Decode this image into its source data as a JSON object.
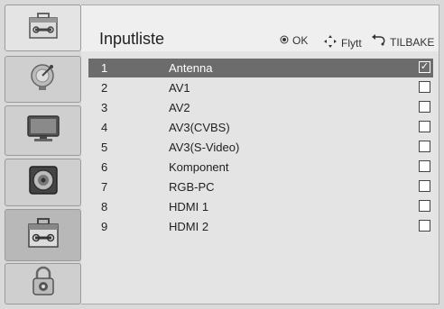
{
  "header": {
    "title": "Inputliste",
    "hints": {
      "ok_label": "OK",
      "move_label": "Flytt",
      "back_label": "TILBAKE"
    }
  },
  "sidebar": {
    "tabs": [
      {
        "icon": "toolbox-icon"
      },
      {
        "icon": "satellite-dish-icon"
      },
      {
        "icon": "tv-monitor-icon"
      },
      {
        "icon": "speaker-icon"
      },
      {
        "icon": "toolbox-icon",
        "selected": true
      },
      {
        "icon": "padlock-icon"
      }
    ]
  },
  "inputs": [
    {
      "num": "1",
      "name": "Antenna",
      "checked": true,
      "selected": true
    },
    {
      "num": "2",
      "name": "AV1",
      "checked": false
    },
    {
      "num": "3",
      "name": "AV2",
      "checked": false
    },
    {
      "num": "4",
      "name": "AV3(CVBS)",
      "checked": false
    },
    {
      "num": "5",
      "name": "AV3(S-Video)",
      "checked": false
    },
    {
      "num": "6",
      "name": "Komponent",
      "checked": false
    },
    {
      "num": "7",
      "name": "RGB-PC",
      "checked": false
    },
    {
      "num": "8",
      "name": "HDMI 1",
      "checked": false
    },
    {
      "num": "9",
      "name": "HDMI 2",
      "checked": false
    }
  ],
  "checkmark": "✓",
  "colors": {
    "selection": "#6c6c6c",
    "panel": "#e4e4e4",
    "frame": "#d9d9d9"
  }
}
